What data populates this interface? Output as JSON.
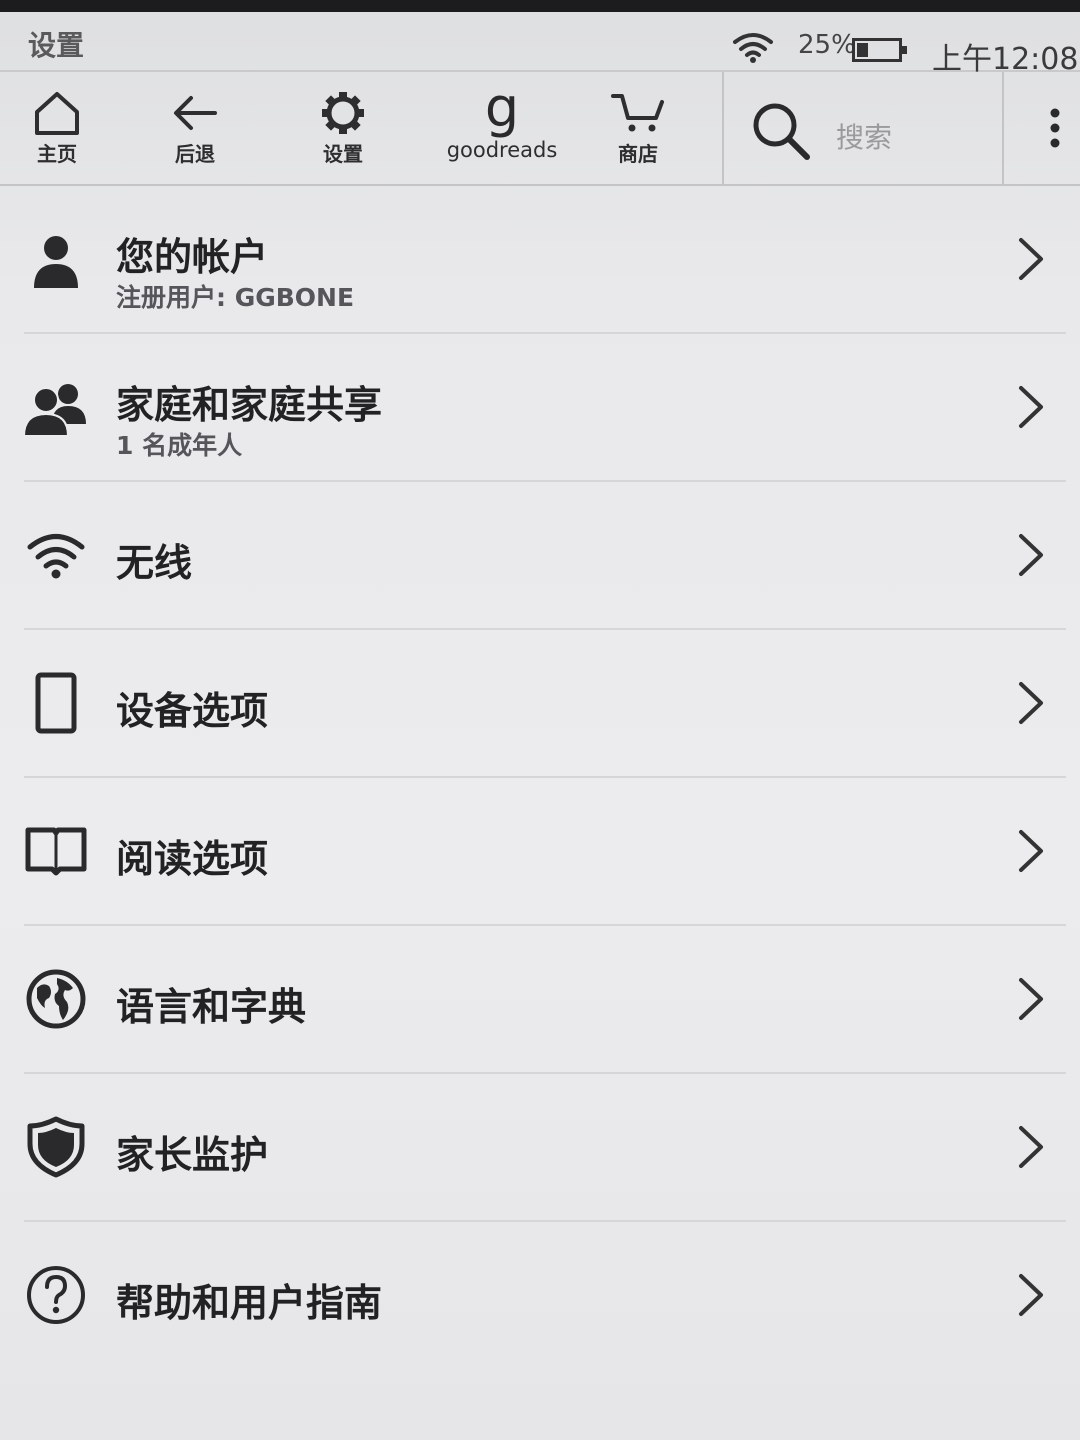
{
  "status_bar": {
    "title": "设置",
    "battery": "25%",
    "time": "上午12:08"
  },
  "toolbar": {
    "home_label": "主页",
    "back_label": "后退",
    "settings_label": "设置",
    "goodreads_glyph": "g",
    "goodreads_label": "goodreads",
    "store_label": "商店",
    "search_placeholder": "搜索"
  },
  "settings_list": {
    "items": [
      {
        "title": "您的帐户",
        "subtitle": "注册用户: GGBONE",
        "icon": "person-icon"
      },
      {
        "title": "家庭和家庭共享",
        "subtitle": "1 名成年人",
        "icon": "people-icon"
      },
      {
        "title": "无线",
        "icon": "wifi-icon"
      },
      {
        "title": "设备选项",
        "icon": "device-icon"
      },
      {
        "title": "阅读选项",
        "icon": "book-icon"
      },
      {
        "title": "语言和字典",
        "icon": "globe-icon"
      },
      {
        "title": "家长监护",
        "icon": "shield-icon"
      },
      {
        "title": "帮助和用户指南",
        "icon": "help-icon"
      }
    ]
  }
}
